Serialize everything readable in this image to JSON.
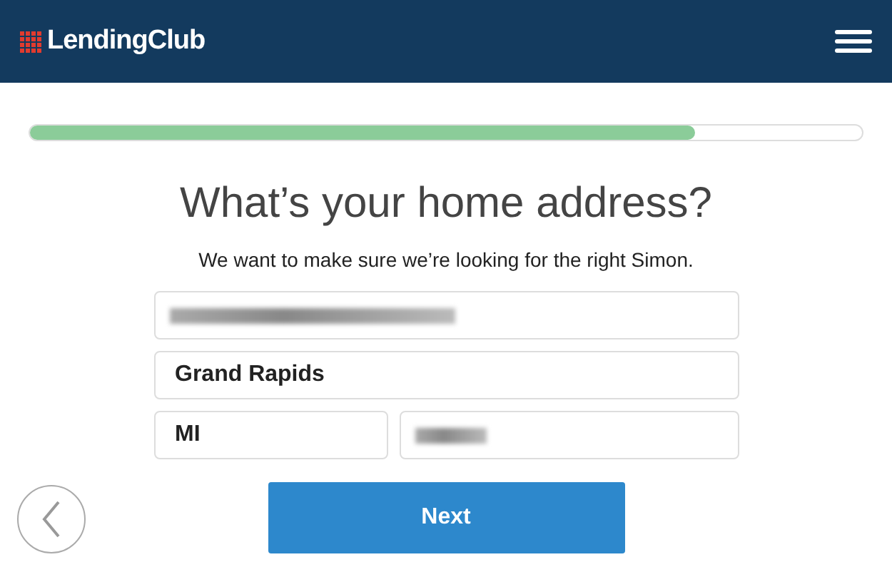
{
  "header": {
    "brand": "LendingClub"
  },
  "progress": {
    "level": 0.8
  },
  "title": "What’s your home address?",
  "subtitle": "We want to make sure we’re looking for the right Simon.",
  "field_rows": [
    [
      {
        "kind": "redacted"
      }
    ],
    [
      {
        "kind": "text",
        "value": "Grand Rapids"
      }
    ],
    [
      {
        "kind": "text",
        "value": "MI"
      },
      {
        "kind": "redacted"
      }
    ]
  ],
  "next_button": "Next"
}
